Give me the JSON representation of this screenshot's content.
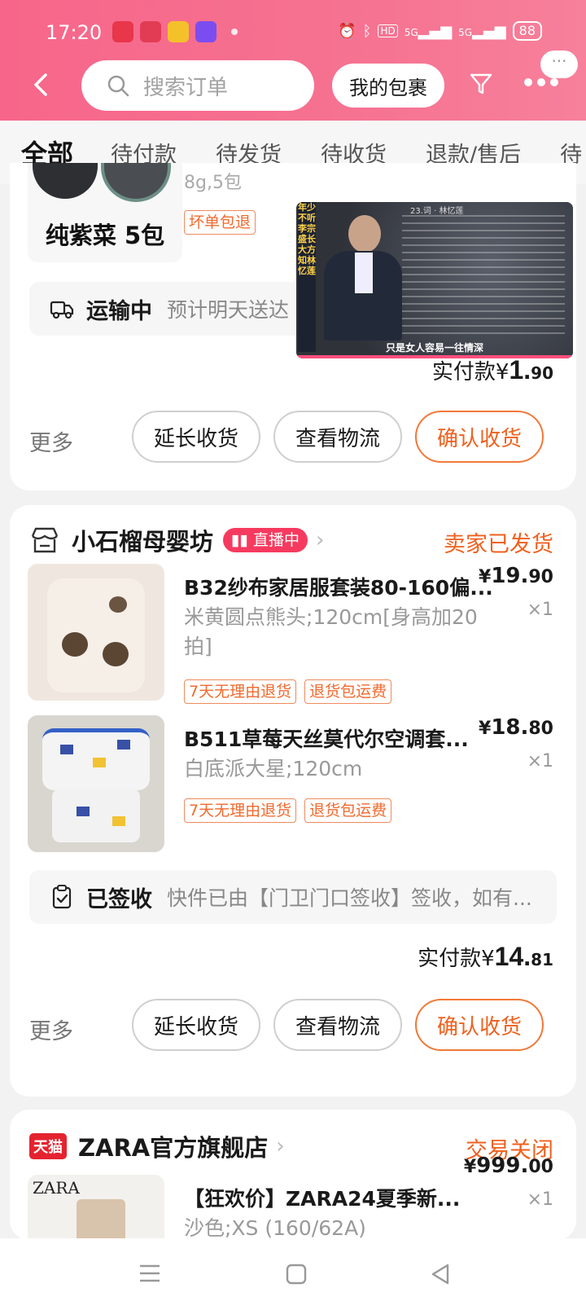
{
  "status_bar": {
    "time": "17:20",
    "network_1": "5G",
    "network_2": "5G",
    "battery": "88"
  },
  "header": {
    "search_placeholder": "搜索订单",
    "my_packages": "我的包裹",
    "bubble_dots": "···"
  },
  "tabs": [
    "全部",
    "待付款",
    "待发货",
    "待收货",
    "退款/售后",
    "待"
  ],
  "order1": {
    "thumb_caption": "纯紫菜 5包",
    "spec_partial": "8g,5包",
    "tags": [
      "坏单包退"
    ],
    "logistics_status": "运输中",
    "logistics_desc": "预计明天送达",
    "paid_label": "实付款¥",
    "paid_int": "1.",
    "paid_dec": "90",
    "more": "更多",
    "buttons": [
      "延长收货",
      "查看物流",
      "确认收货"
    ]
  },
  "float_video": {
    "side_text": "年少不听李宗盛长大方知林忆莲",
    "top_text": "23.词 · 林忆莲",
    "bottom_text": "只是女人容易一往情深"
  },
  "order2": {
    "shop_name": "小石榴母婴坊",
    "live_badge": "直播中",
    "status": "卖家已发货",
    "items": [
      {
        "title": "B32纱布家居服套装80-160偏...",
        "spec": "米黄圆点熊头;120cm[身高加20拍]",
        "price_int": "19.",
        "price_dec": "90",
        "qty": "×1",
        "tags": [
          "7天无理由退货",
          "退货包运费"
        ]
      },
      {
        "title": "B511草莓天丝莫代尔空调套...",
        "spec": "白底派大星;120cm",
        "price_int": "18.",
        "price_dec": "80",
        "qty": "×1",
        "tags": [
          "7天无理由退货",
          "退货包运费"
        ]
      }
    ],
    "logistics_status": "已签收",
    "logistics_desc": "快件已由【门卫门口签收】签收，如有...",
    "paid_label": "实付款¥",
    "paid_int": "14.",
    "paid_dec": "81",
    "more": "更多",
    "buttons": [
      "延长收货",
      "查看物流",
      "确认收货"
    ]
  },
  "order3": {
    "tmall_badge": "天猫",
    "shop_name": "ZARA官方旗舰店",
    "status": "交易关闭",
    "thumb_brand": "ZARA",
    "title": "【狂欢价】ZARA24夏季新...",
    "spec_partial": "沙色;XS (160/62A)",
    "price_int": "999.",
    "price_dec": "00",
    "qty": "×1"
  },
  "colors": {
    "header_pink": "#f67291",
    "accent_orange": "#f0601d",
    "live_red": "#f63a5f"
  }
}
